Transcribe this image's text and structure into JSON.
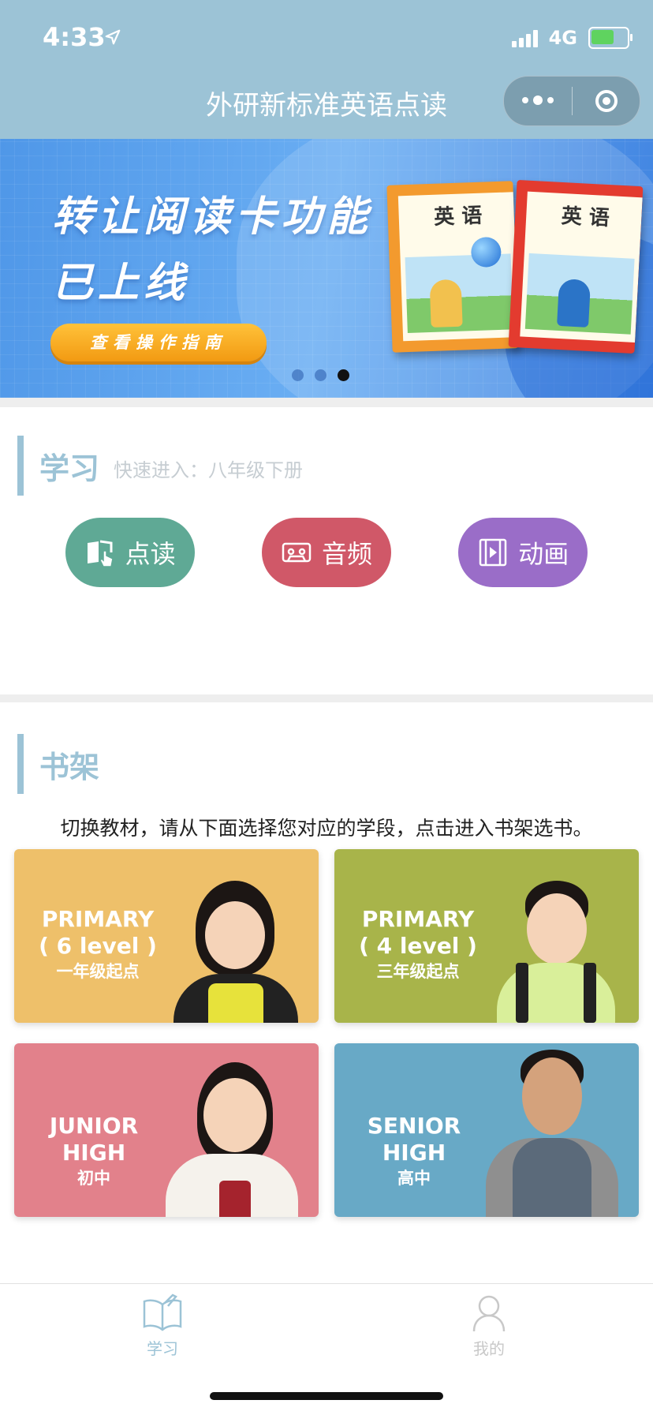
{
  "status_bar": {
    "time": "4:33",
    "network": "4G",
    "battery_level": 0.7
  },
  "nav": {
    "title": "外研新标准英语点读",
    "more_icon": "more-dots-icon",
    "close_icon": "target-icon"
  },
  "banner": {
    "line1": "转让阅读卡功能",
    "line2": "已上线",
    "button": "查看操作指南",
    "book_titles": [
      "英 语",
      "英 语"
    ],
    "page_count": 3,
    "active_index": 2
  },
  "study": {
    "title": "学习",
    "subtitle": "快速进入：八年级下册",
    "buttons": [
      {
        "label": "点读",
        "icon": "book-touch-icon",
        "color": "#5fa995"
      },
      {
        "label": "音频",
        "icon": "cassette-icon",
        "color": "#d05868"
      },
      {
        "label": "动画",
        "icon": "film-icon",
        "color": "#9a6dc8"
      }
    ]
  },
  "shelf": {
    "title": "书架",
    "hint": "切换教材，请从下面选择您对应的学段，点击进入书架选书。",
    "tiles": [
      {
        "l1": "PRIMARY",
        "l2": "( 6 level )",
        "l3": "一年级起点",
        "color": "#eec06a"
      },
      {
        "l1": "PRIMARY",
        "l2": "( 4 level )",
        "l3": "三年级起点",
        "color": "#a8b44a"
      },
      {
        "l1": "JUNIOR",
        "l2": "HIGH",
        "l3": "初中",
        "color": "#e2818b"
      },
      {
        "l1": "SENIOR",
        "l2": "HIGH",
        "l3": "高中",
        "color": "#68a9c6"
      }
    ]
  },
  "tabbar": {
    "items": [
      {
        "label": "学习",
        "icon": "open-book-icon",
        "active": true
      },
      {
        "label": "我的",
        "icon": "person-icon",
        "active": false
      }
    ]
  }
}
